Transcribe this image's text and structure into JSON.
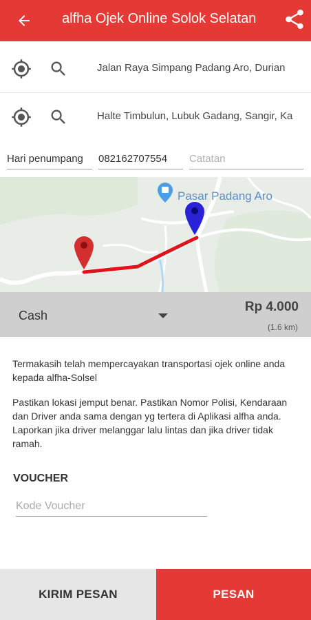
{
  "header": {
    "title": "alfha Ojek Online Solok Selatan",
    "back_icon": "arrow-back-icon",
    "share_icon": "share-icon",
    "color": "#e53935"
  },
  "pickup": {
    "address": "Jalan Raya Simpang Padang Aro, Durian",
    "location_icon": "my-location-icon",
    "search_icon": "search-icon"
  },
  "destination": {
    "address": "Halte Timbulun, Lubuk Gadang, Sangir, Ka",
    "location_icon": "my-location-icon",
    "search_icon": "search-icon"
  },
  "form": {
    "passenger_name": "Hari penumpang",
    "phone": "082162707554",
    "note_placeholder": "Catatan"
  },
  "map": {
    "place_label": "Pasar Padang Aro",
    "route_color": "#e0131b",
    "origin_pin_color": "#d32f2f",
    "destination_pin_color": "#2a22d6"
  },
  "payment": {
    "method": "Cash",
    "price": "Rp 4.000",
    "distance": "(1.6 km)"
  },
  "info": {
    "thanks": "Termakasih telah mempercayakan transportasi ojek online anda kepada alfha-Solsel",
    "notice": "Pastikan lokasi jemput benar. Pastikan Nomor Polisi, Kendaraan dan Driver anda sama dengan yg tertera di Aplikasi alfha anda. Laporkan jika driver melanggar lalu lintas dan jika driver tidak ramah."
  },
  "voucher": {
    "heading": "VOUCHER",
    "placeholder": "Kode Voucher"
  },
  "actions": {
    "send_message": "KIRIM PESAN",
    "order": "PESAN"
  }
}
